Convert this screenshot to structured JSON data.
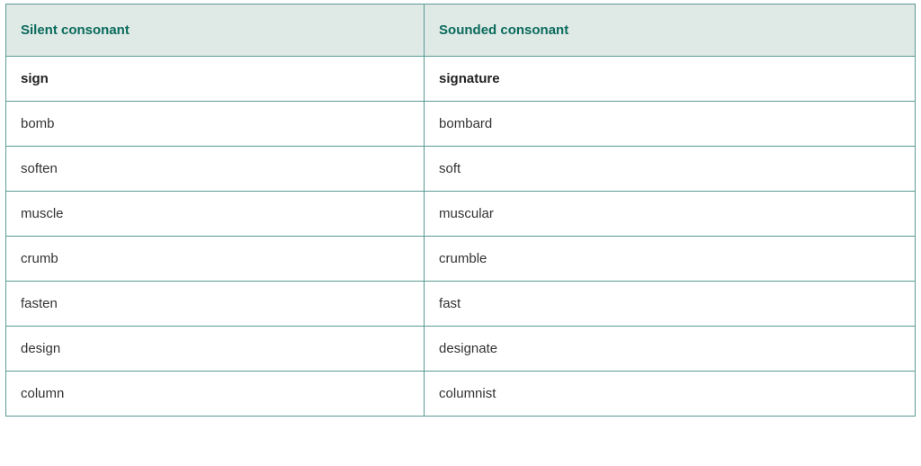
{
  "chart_data": {
    "type": "table",
    "title": "",
    "headers": [
      "Silent consonant",
      "Sounded consonant"
    ],
    "rows": [
      {
        "silent": "sign",
        "sounded": "signature",
        "bold": true
      },
      {
        "silent": "bomb",
        "sounded": "bombard",
        "bold": false
      },
      {
        "silent": "soften",
        "sounded": "soft",
        "bold": false
      },
      {
        "silent": "muscle",
        "sounded": "muscular",
        "bold": false
      },
      {
        "silent": "crumb",
        "sounded": "crumble",
        "bold": false
      },
      {
        "silent": "fasten",
        "sounded": "fast",
        "bold": false
      },
      {
        "silent": "design",
        "sounded": "designate",
        "bold": false
      },
      {
        "silent": "column",
        "sounded": "columnist",
        "bold": false
      }
    ]
  }
}
